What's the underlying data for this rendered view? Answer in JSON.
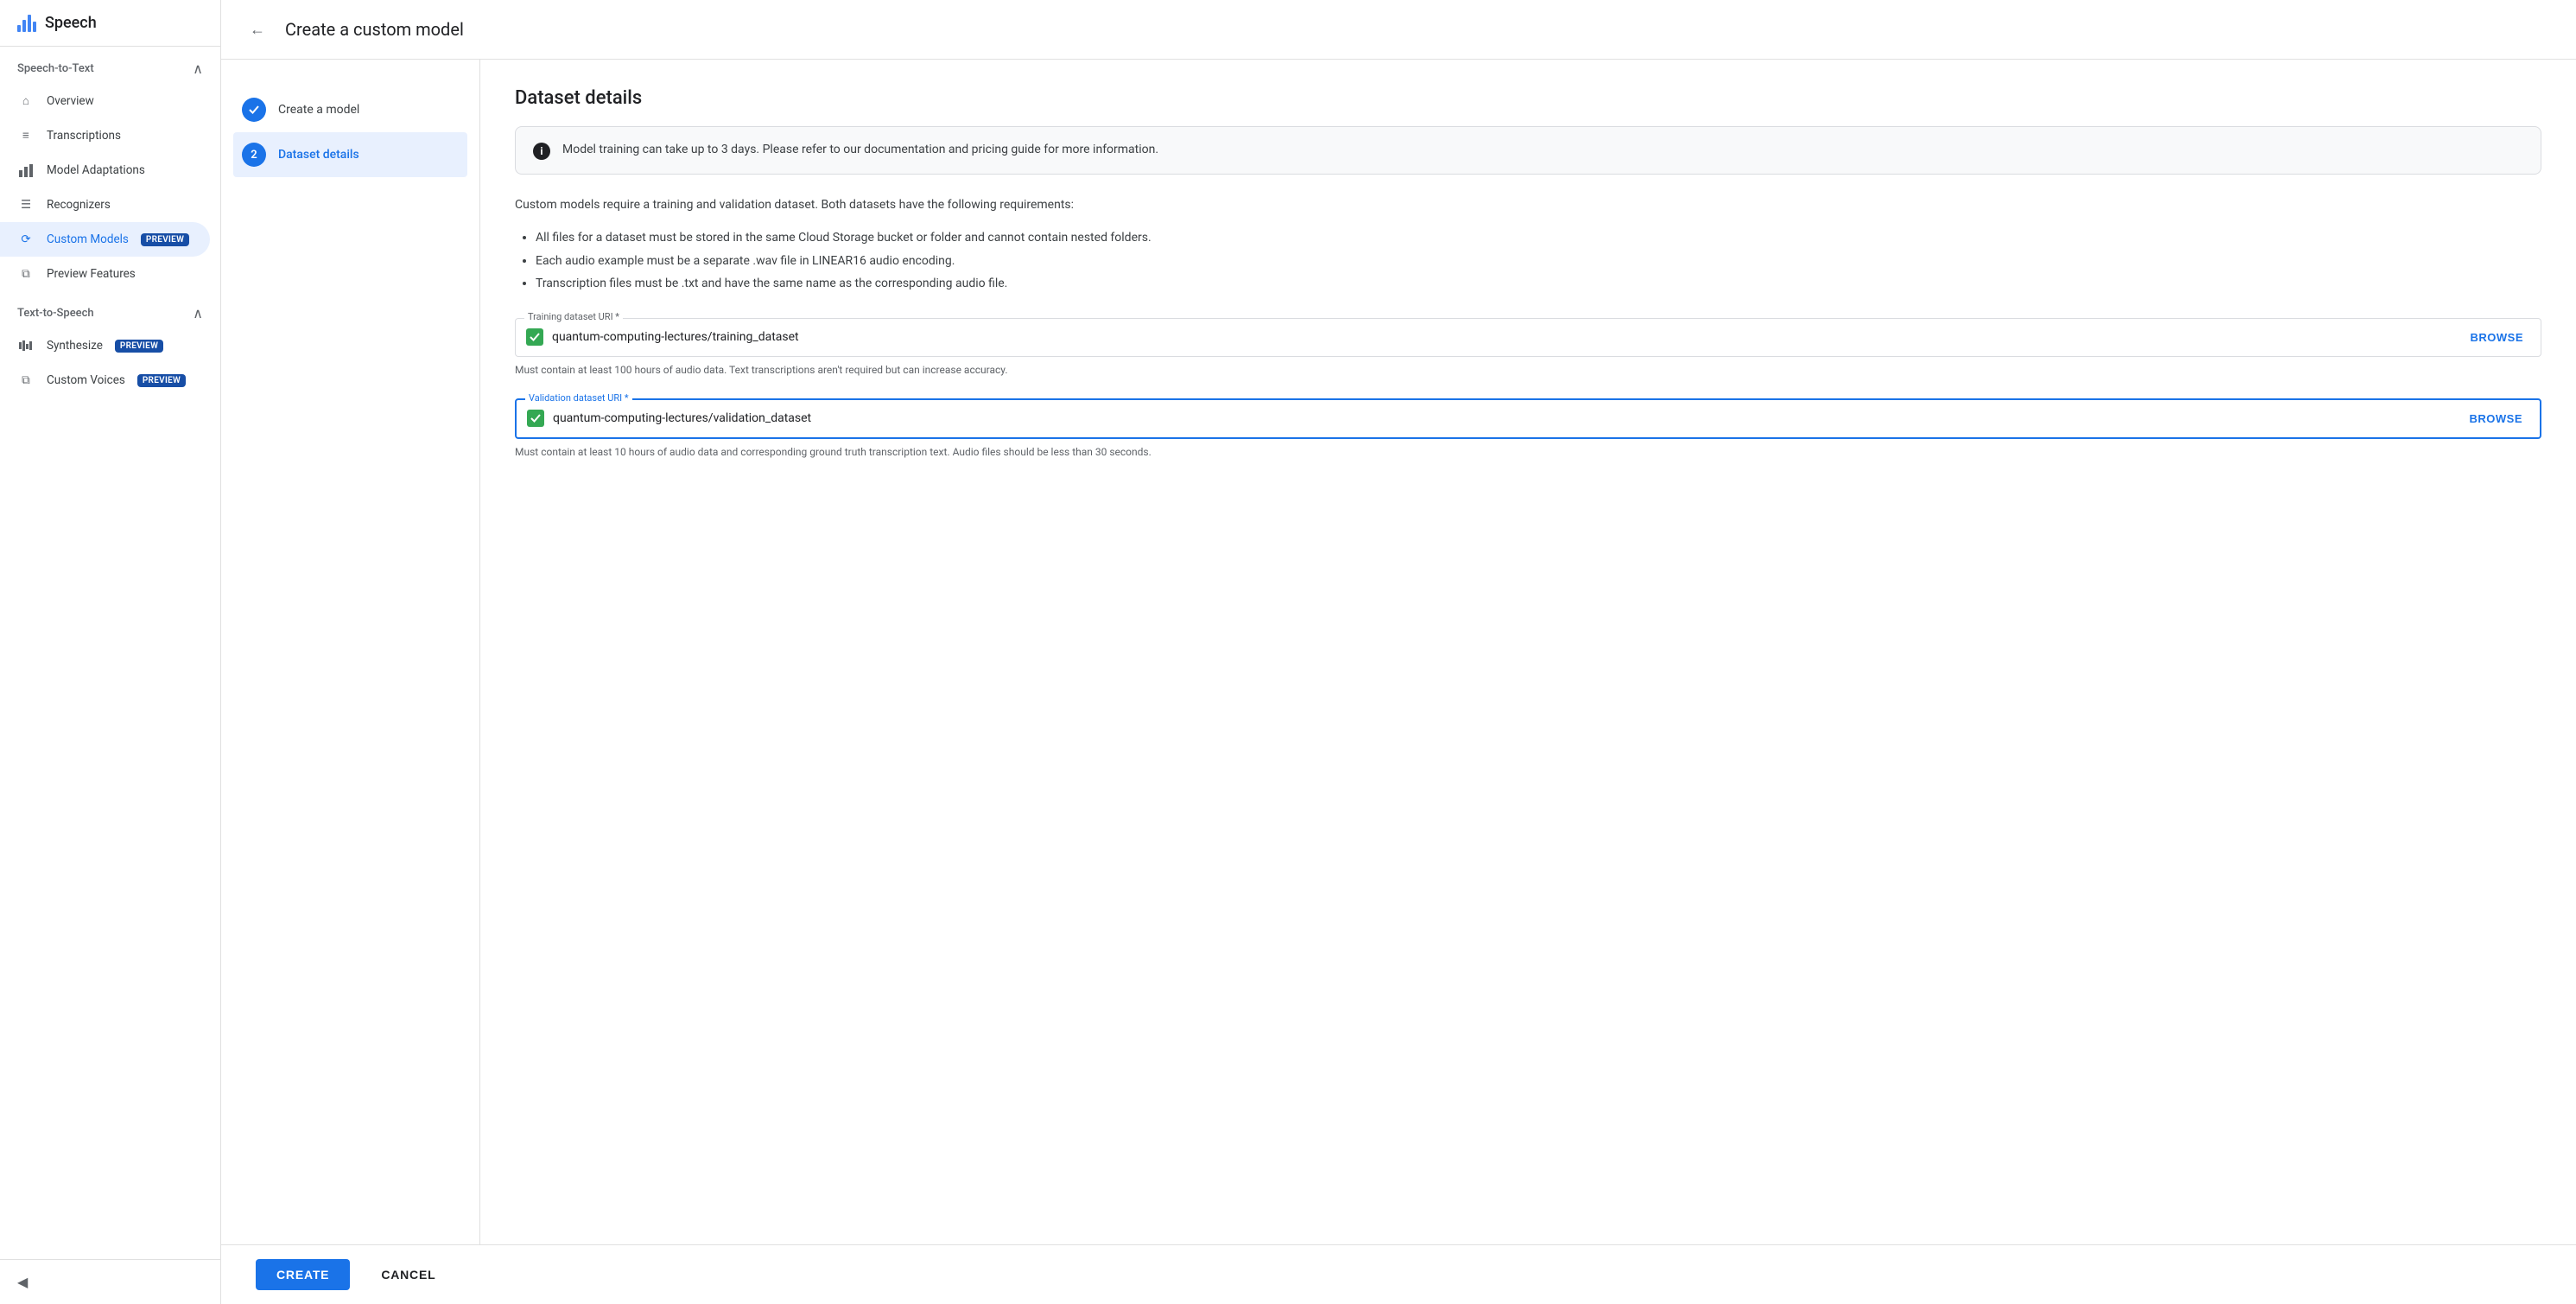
{
  "app": {
    "title": "Speech"
  },
  "sidebar": {
    "speech_to_text_label": "Speech-to-Text",
    "text_to_speech_label": "Text-to-Speech",
    "items_stt": [
      {
        "id": "overview",
        "label": "Overview",
        "icon": "home"
      },
      {
        "id": "transcriptions",
        "label": "Transcriptions",
        "icon": "list"
      },
      {
        "id": "model-adaptations",
        "label": "Model Adaptations",
        "icon": "bar-chart"
      },
      {
        "id": "recognizers",
        "label": "Recognizers",
        "icon": "menu"
      },
      {
        "id": "custom-models",
        "label": "Custom Models",
        "icon": "refresh",
        "badge": "PREVIEW",
        "active": true
      },
      {
        "id": "preview-features",
        "label": "Preview Features",
        "icon": "layers"
      }
    ],
    "items_tts": [
      {
        "id": "synthesize",
        "label": "Synthesize",
        "icon": "music",
        "badge": "PREVIEW"
      },
      {
        "id": "custom-voices",
        "label": "Custom Voices",
        "icon": "layers",
        "badge": "PREVIEW",
        "active": false
      }
    ],
    "collapse_label": "◀"
  },
  "topbar": {
    "back_label": "←",
    "title": "Create a custom model"
  },
  "stepper": {
    "steps": [
      {
        "id": "create-model",
        "label": "Create a model",
        "state": "completed",
        "number": "✓"
      },
      {
        "id": "dataset-details",
        "label": "Dataset details",
        "state": "active",
        "number": "2"
      }
    ]
  },
  "form": {
    "title": "Dataset details",
    "info_message": "Model training can take up to 3 days. Please refer to our documentation and pricing guide for more information.",
    "requirements_text": "Custom models require a training and validation dataset. Both datasets have the following requirements:",
    "bullets": [
      "All files for a dataset must be stored in the same Cloud Storage bucket or folder and cannot contain nested folders.",
      "Each audio example must be a separate .wav file in LINEAR16 audio encoding.",
      "Transcription files must be .txt and have the same name as the corresponding audio file."
    ],
    "training_field": {
      "label": "Training dataset URI *",
      "value": "quantum-computing-lectures/training_dataset",
      "browse_label": "BROWSE",
      "hint": "Must contain at least 100 hours of audio data. Text transcriptions aren't required but can increase accuracy."
    },
    "validation_field": {
      "label": "Validation dataset URI *",
      "value": "quantum-computing-lectures/validation_dataset",
      "browse_label": "BROWSE",
      "hint": "Must contain at least 10 hours of audio data and corresponding ground truth transcription text. Audio files should be less than 30 seconds."
    }
  },
  "actions": {
    "create_label": "CREATE",
    "cancel_label": "CANCEL"
  }
}
